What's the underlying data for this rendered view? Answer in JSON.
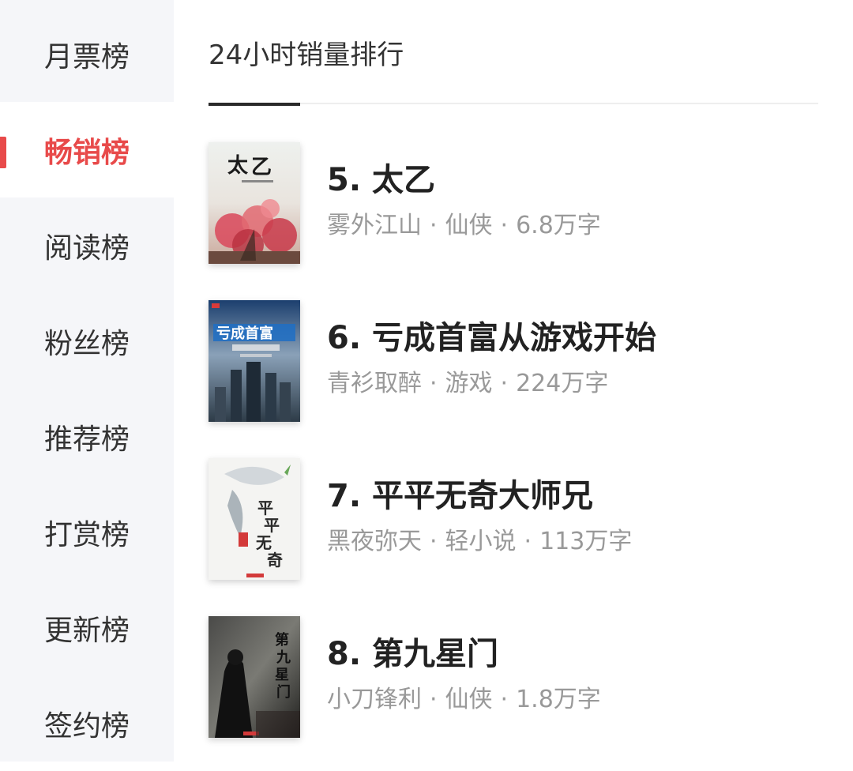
{
  "sidebar": {
    "items": [
      {
        "label": "月票榜",
        "active": false
      },
      {
        "label": "畅销榜",
        "active": true
      },
      {
        "label": "阅读榜",
        "active": false
      },
      {
        "label": "粉丝榜",
        "active": false
      },
      {
        "label": "推荐榜",
        "active": false
      },
      {
        "label": "打赏榜",
        "active": false
      },
      {
        "label": "更新榜",
        "active": false
      },
      {
        "label": "签约榜",
        "active": false
      }
    ],
    "active_color": "#e84a4a"
  },
  "main": {
    "title": "24小时销量排行",
    "books": [
      {
        "rank_title": "5. 太乙",
        "author": "雾外江山",
        "genre": "仙侠",
        "words": "6.8万字",
        "cover_icon": "taiyi-cover"
      },
      {
        "rank_title": "6. 亏成首富从游戏开始",
        "author": "青衫取醉",
        "genre": "游戏",
        "words": "224万字",
        "cover_icon": "kuicheng-cover"
      },
      {
        "rank_title": "7. 平平无奇大师兄",
        "author": "黑夜弥天",
        "genre": "轻小说",
        "words": "113万字",
        "cover_icon": "pingping-cover"
      },
      {
        "rank_title": "8. 第九星门",
        "author": "小刀锋利",
        "genre": "仙侠",
        "words": "1.8万字",
        "cover_icon": "dijiu-cover"
      }
    ],
    "meta_separator": "·"
  }
}
